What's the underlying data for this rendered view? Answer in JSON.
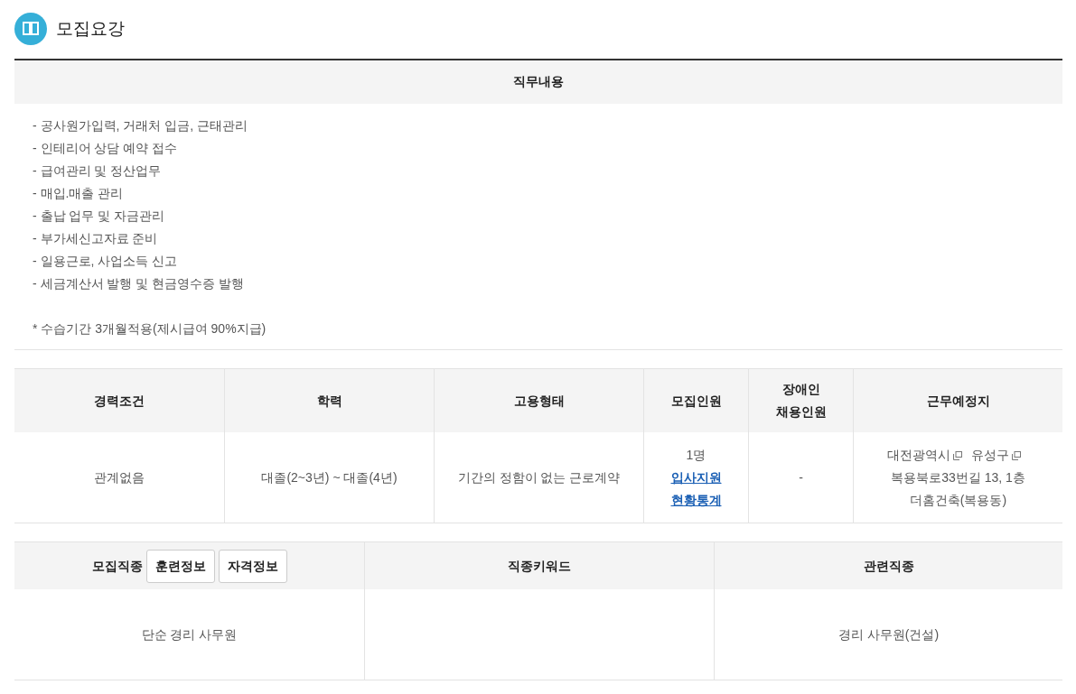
{
  "section": {
    "title": "모집요강"
  },
  "duties": {
    "heading": "직무내용",
    "lines": [
      "- 공사원가입력, 거래처 입금, 근태관리",
      "- 인테리어 상담 예약 접수",
      "- 급여관리 및 정산업무",
      "- 매입.매출 관리",
      "- 출납 업무 및 자금관리",
      "- 부가세신고자료 준비",
      "- 일용근로, 사업소득 신고",
      "- 세금계산서 발행 및 현금영수증 발행"
    ],
    "note": "* 수습기간 3개월적용(제시급여 90%지급)"
  },
  "conditions": {
    "columns": [
      "경력조건",
      "학력",
      "고용형태",
      "모집인원",
      "장애인 채용인원",
      "근무예정지"
    ],
    "experience": "관계없음",
    "education": "대졸(2~3년) ~ 대졸(4년)",
    "employment_type": "기간의 정함이 없는 근로계약",
    "headcount": {
      "count": "1명",
      "link": "입사지원 현황통계"
    },
    "disabled_hires": "-",
    "location": {
      "regions": [
        "대전광역시",
        "유성구"
      ],
      "address": "복용북로33번길 13, 1층 더홈건축(복용동)"
    }
  },
  "occupation": {
    "columns": [
      "모집직종",
      "직종키워드",
      "관련직종"
    ],
    "buttons": [
      "훈련정보",
      "자격정보"
    ],
    "job": "단순 경리 사무원",
    "related": "경리 사무원(건설)"
  }
}
